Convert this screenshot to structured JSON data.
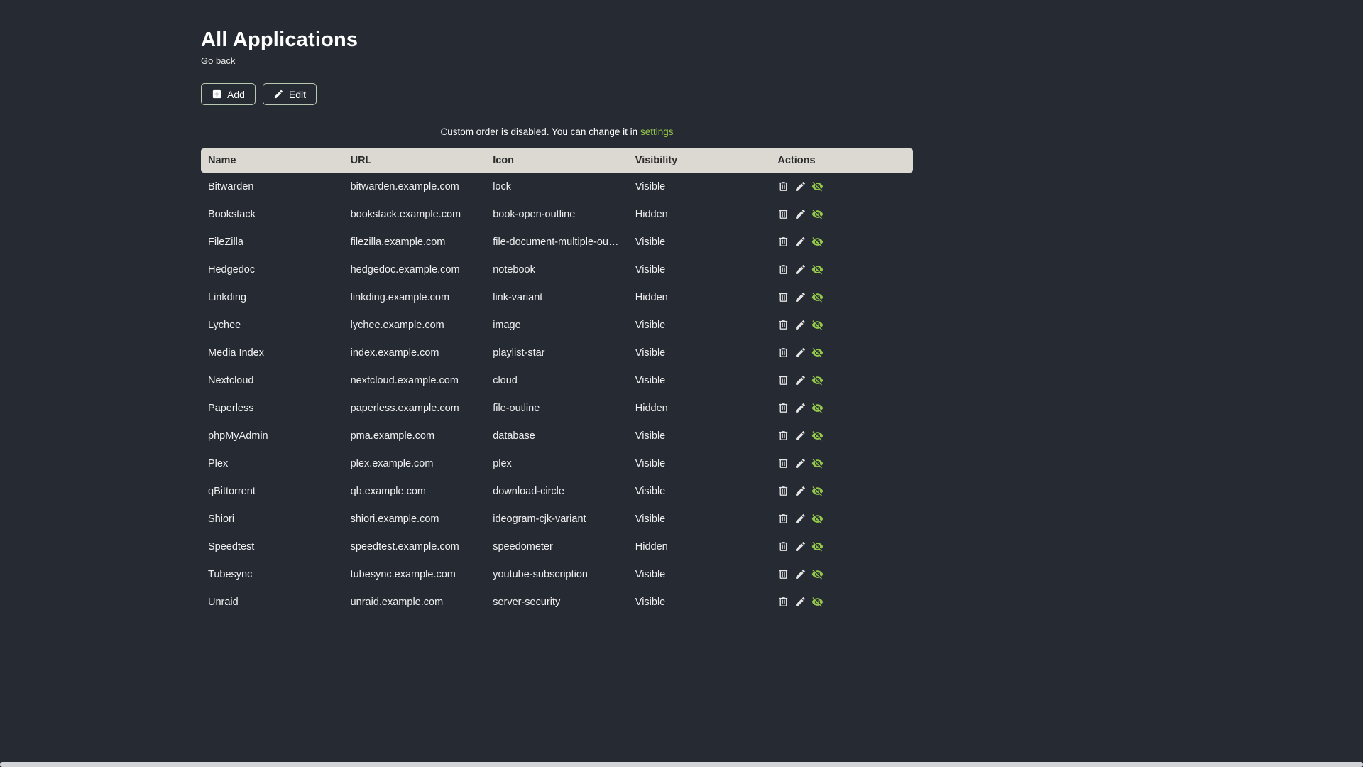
{
  "page": {
    "title": "All Applications",
    "back_label": "Go back"
  },
  "toolbar": {
    "add_label": "Add",
    "edit_label": "Edit"
  },
  "notice": {
    "text": "Custom order is disabled. You can change it in",
    "link_label": "settings"
  },
  "table": {
    "headers": [
      "Name",
      "URL",
      "Icon",
      "Visibility",
      "Actions"
    ],
    "action_icons": [
      "trash-icon",
      "pencil-icon",
      "visibility-toggle-icon"
    ],
    "rows": [
      {
        "name": "Bitwarden",
        "url": "bitwarden.example.com",
        "icon": "lock",
        "visibility": "Visible"
      },
      {
        "name": "Bookstack",
        "url": "bookstack.example.com",
        "icon": "book-open-outline",
        "visibility": "Hidden"
      },
      {
        "name": "FileZilla",
        "url": "filezilla.example.com",
        "icon": "file-document-multiple-outline",
        "visibility": "Visible"
      },
      {
        "name": "Hedgedoc",
        "url": "hedgedoc.example.com",
        "icon": "notebook",
        "visibility": "Visible"
      },
      {
        "name": "Linkding",
        "url": "linkding.example.com",
        "icon": "link-variant",
        "visibility": "Hidden"
      },
      {
        "name": "Lychee",
        "url": "lychee.example.com",
        "icon": "image",
        "visibility": "Visible"
      },
      {
        "name": "Media Index",
        "url": "index.example.com",
        "icon": "playlist-star",
        "visibility": "Visible"
      },
      {
        "name": "Nextcloud",
        "url": "nextcloud.example.com",
        "icon": "cloud",
        "visibility": "Visible"
      },
      {
        "name": "Paperless",
        "url": "paperless.example.com",
        "icon": "file-outline",
        "visibility": "Hidden"
      },
      {
        "name": "phpMyAdmin",
        "url": "pma.example.com",
        "icon": "database",
        "visibility": "Visible"
      },
      {
        "name": "Plex",
        "url": "plex.example.com",
        "icon": "plex",
        "visibility": "Visible"
      },
      {
        "name": "qBittorrent",
        "url": "qb.example.com",
        "icon": "download-circle",
        "visibility": "Visible"
      },
      {
        "name": "Shiori",
        "url": "shiori.example.com",
        "icon": "ideogram-cjk-variant",
        "visibility": "Visible"
      },
      {
        "name": "Speedtest",
        "url": "speedtest.example.com",
        "icon": "speedometer",
        "visibility": "Hidden"
      },
      {
        "name": "Tubesync",
        "url": "tubesync.example.com",
        "icon": "youtube-subscription",
        "visibility": "Visible"
      },
      {
        "name": "Unraid",
        "url": "unraid.example.com",
        "icon": "server-security",
        "visibility": "Visible"
      }
    ]
  },
  "colors": {
    "background": "#252a33",
    "accent_green": "#94c849",
    "table_header_bg": "#dcd9d3",
    "text": "#f0f0f0"
  }
}
